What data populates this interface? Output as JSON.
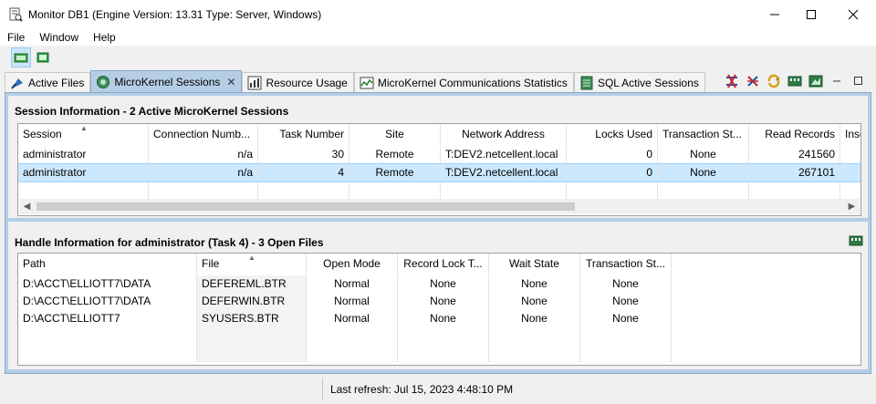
{
  "window": {
    "title": "Monitor DB1   (Engine Version: 13.31  Type: Server, Windows)",
    "minimize": "—",
    "maximize": "☐",
    "close": "✕"
  },
  "menu": {
    "file": "File",
    "window": "Window",
    "help": "Help"
  },
  "tabs": [
    {
      "label": "Active Files",
      "icon": "active-files-icon"
    },
    {
      "label": "MicroKernel Sessions",
      "icon": "sessions-icon",
      "selected": true
    },
    {
      "label": "Resource Usage",
      "icon": "bar-chart-icon"
    },
    {
      "label": "MicroKernel Communications Statistics",
      "icon": "line-chart-icon"
    },
    {
      "label": "SQL Active Sessions",
      "icon": "database-icon"
    }
  ],
  "sessions": {
    "title": "Session Information - 2 Active MicroKernel Sessions",
    "columns": [
      "Session",
      "Connection Numb...",
      "Task Number",
      "Site",
      "Network Address",
      "Locks Used",
      "Transaction St...",
      "Read Records",
      "Inse"
    ],
    "rows": [
      [
        "administrator",
        "n/a",
        "30",
        "Remote",
        "T:DEV2.netcellent.local",
        "0",
        "None",
        "241560",
        ""
      ],
      [
        "administrator",
        "n/a",
        "4",
        "Remote",
        "T:DEV2.netcellent.local",
        "0",
        "None",
        "267101",
        ""
      ]
    ],
    "selected_row": 1
  },
  "handles": {
    "title": "Handle Information for administrator (Task 4) - 3 Open Files",
    "columns": [
      "Path",
      "File",
      "Open Mode",
      "Record Lock T...",
      "Wait State",
      "Transaction St..."
    ],
    "rows": [
      [
        "D:\\ACCT\\ELLIOTT7\\DATA",
        "DEFEREML.BTR",
        "Normal",
        "None",
        "None",
        "None"
      ],
      [
        "D:\\ACCT\\ELLIOTT7\\DATA",
        "DEFERWIN.BTR",
        "Normal",
        "None",
        "None",
        "None"
      ],
      [
        "D:\\ACCT\\ELLIOTT7",
        "SYUSERS.BTR",
        "Normal",
        "None",
        "None",
        "None"
      ]
    ]
  },
  "status": {
    "last_refresh": "Last refresh: Jul 15, 2023 4:48:10 PM"
  }
}
